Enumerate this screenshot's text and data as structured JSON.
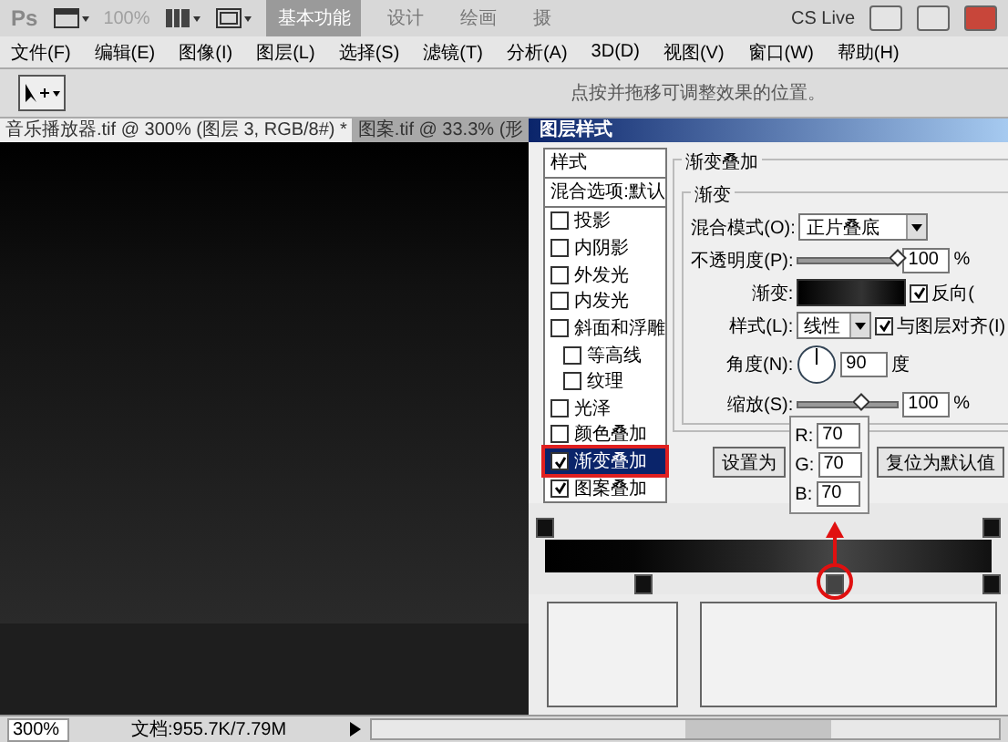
{
  "top_bar": {
    "app": "Ps",
    "zoom": "100%",
    "workspaces": [
      {
        "label": "基本功能",
        "selected": true
      },
      {
        "label": "设计",
        "selected": false
      },
      {
        "label": "绘画",
        "selected": false
      },
      {
        "label": "摄",
        "selected": false
      }
    ],
    "cs_live": "CS Live"
  },
  "menu": [
    "文件(F)",
    "编辑(E)",
    "图像(I)",
    "图层(L)",
    "选择(S)",
    "滤镜(T)",
    "分析(A)",
    "3D(D)",
    "视图(V)",
    "窗口(W)",
    "帮助(H)"
  ],
  "options_bar": {
    "hint": "点按并拖移可调整效果的位置。"
  },
  "document_tabs": [
    {
      "label": "音乐播放器.tif @ 300% (图层 3, RGB/8#) *",
      "selected": true
    },
    {
      "label": "图案.tif @ 33.3% (形",
      "selected": false
    }
  ],
  "dialog": {
    "title": "图层样式",
    "styles_header": "样式",
    "blend_options": "混合选项:默认",
    "styles": [
      {
        "label": "投影",
        "checked": false,
        "selected": false
      },
      {
        "label": "内阴影",
        "checked": false,
        "selected": false
      },
      {
        "label": "外发光",
        "checked": false,
        "selected": false
      },
      {
        "label": "内发光",
        "checked": false,
        "selected": false
      },
      {
        "label": "斜面和浮雕",
        "checked": false,
        "selected": false,
        "children": [
          {
            "label": "等高线",
            "checked": false,
            "selected": false
          },
          {
            "label": "纹理",
            "checked": false,
            "selected": false
          }
        ]
      },
      {
        "label": "光泽",
        "checked": false,
        "selected": false
      },
      {
        "label": "颜色叠加",
        "checked": false,
        "selected": false
      },
      {
        "label": "渐变叠加",
        "checked": true,
        "selected": true
      },
      {
        "label": "图案叠加",
        "checked": true,
        "selected": false
      }
    ],
    "section_title": "渐变叠加",
    "group_title": "渐变",
    "blend_mode": {
      "label": "混合模式(O):",
      "value": "正片叠底"
    },
    "opacity": {
      "label": "不透明度(P):",
      "level": 1,
      "value": "100",
      "unit": "%"
    },
    "gradient": {
      "label": "渐变:",
      "reverse": {
        "label": "反向(",
        "checked": true
      }
    },
    "style": {
      "label": "样式(L):",
      "value": "线性",
      "align": {
        "label": "与图层对齐(I)",
        "checked": true
      }
    },
    "angle": {
      "label": "角度(N):",
      "value": "90",
      "unit": "度"
    },
    "scale": {
      "label": "缩放(S):",
      "level": 0.63,
      "value": "100",
      "unit": "%"
    },
    "buttons": [
      "设置为",
      "复位为默认值"
    ],
    "color_popup": [
      {
        "label": "R:",
        "value": "70"
      },
      {
        "label": "G:",
        "value": "70"
      },
      {
        "label": "B:",
        "value": "70"
      }
    ]
  },
  "gradient_editor": {
    "opacity_stops": [
      {
        "level": 0
      },
      {
        "level": 1
      }
    ],
    "color_stops": [
      {
        "level": 0.22,
        "selected": false
      },
      {
        "level": 0.65,
        "selected": true
      },
      {
        "level": 1,
        "selected": false
      }
    ]
  },
  "status_bar": {
    "zoom": "300%",
    "document": "文档:955.7K/7.79M"
  }
}
